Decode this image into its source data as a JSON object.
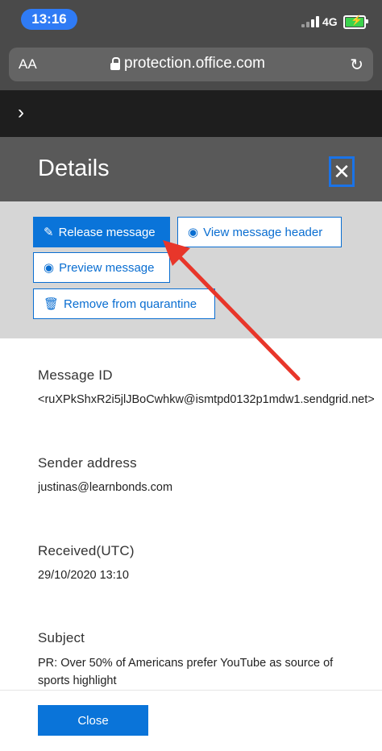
{
  "status_bar": {
    "time": "13:16",
    "network": "4G"
  },
  "browser": {
    "text_size_label": "AA",
    "url": "protection.office.com"
  },
  "panel": {
    "title": "Details"
  },
  "actions": {
    "release": "Release message",
    "view_header": "View message header",
    "preview": "Preview message",
    "remove": "Remove from quarantine"
  },
  "fields": [
    {
      "label": "Message ID",
      "value": "<ruXPkShxR2i5jlJBoCwhkw@ismtpd0132p1mdw1.sendgrid.net>"
    },
    {
      "label": "Sender address",
      "value": "justinas@learnbonds.com"
    },
    {
      "label": "Received(UTC)",
      "value": "29/10/2020 13:10"
    },
    {
      "label": "Subject",
      "value": "PR: Over 50% of Americans prefer YouTube as source of sports highlight"
    }
  ],
  "footer": {
    "close_label": "Close"
  },
  "colors": {
    "accent": "#0a74d9",
    "annotation": "#e8362a"
  }
}
